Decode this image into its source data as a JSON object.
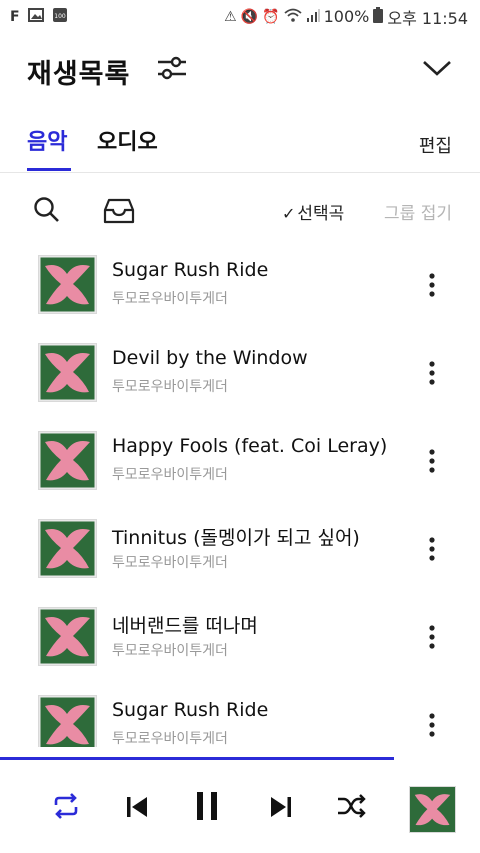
{
  "status_bar": {
    "left_icons": [
      "f-app-icon",
      "gallery-icon",
      "battery-100-icon"
    ],
    "battery_small_label": "100",
    "right_icons": [
      "hotspot-alert-icon",
      "mute-icon",
      "alarm-icon",
      "wifi-icon",
      "signal-icon",
      "battery-icon"
    ],
    "battery": "100%",
    "time": "오후 11:54"
  },
  "header": {
    "title": "재생목록",
    "filter_icon": "sliders-icon",
    "collapse_icon": "chevron-down-icon"
  },
  "tabs": [
    {
      "label": "음악",
      "active": true
    },
    {
      "label": "오디오",
      "active": false
    }
  ],
  "edit_label": "편집",
  "toolbar": {
    "search_icon": "search-icon",
    "inbox_icon": "inbox-icon",
    "select_label": "선택곡",
    "group_fold_label": "그룹 접기"
  },
  "tracks": [
    {
      "title": "Sugar Rush Ride",
      "artist": "투모로우바이투게더"
    },
    {
      "title": "Devil by the Window",
      "artist": "투모로우바이투게더"
    },
    {
      "title": "Happy Fools (feat. Coi Leray)",
      "artist": "투모로우바이투게더"
    },
    {
      "title": "Tinnitus (돌멩이가 되고 싶어)",
      "artist": "투모로우바이투게더"
    },
    {
      "title": "네버랜드를 떠나며",
      "artist": "투모로우바이투게더"
    },
    {
      "title": "Sugar Rush Ride",
      "artist": "투모로우바이투게더"
    }
  ],
  "progress": {
    "fraction": 0.82,
    "color": "#2b2bd8"
  },
  "player": {
    "controls": [
      "repeat-icon",
      "previous-icon",
      "pause-icon",
      "next-icon",
      "shuffle-icon"
    ],
    "accent": "#2b2bd8"
  },
  "colors": {
    "accent": "#2b2bd8",
    "art_green": "#2e6b3a",
    "art_pink": "#e98ca4"
  }
}
